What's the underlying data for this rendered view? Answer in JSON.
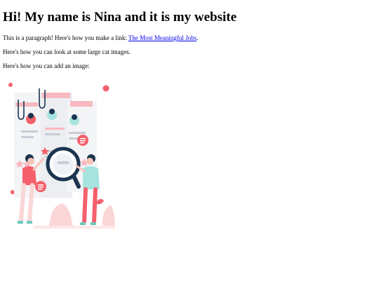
{
  "heading": "Hi! My name is Nina and it is my website",
  "paragraph1": {
    "prefix": "This is a paragraph! Here's how you make a link: ",
    "link_text": "The Most Meaningful Jobs",
    "suffix": "."
  },
  "paragraph2": "Here's how you can look at some large cat images.",
  "paragraph3": "Here's how you can add an image:",
  "image": {
    "icon": "job-search-illustration",
    "colors": {
      "pink": "#f4606c",
      "light_pink": "#fbd6d6",
      "navy": "#1c3550",
      "teal": "#a6e3df",
      "gray": "#c9ccd4"
    }
  }
}
